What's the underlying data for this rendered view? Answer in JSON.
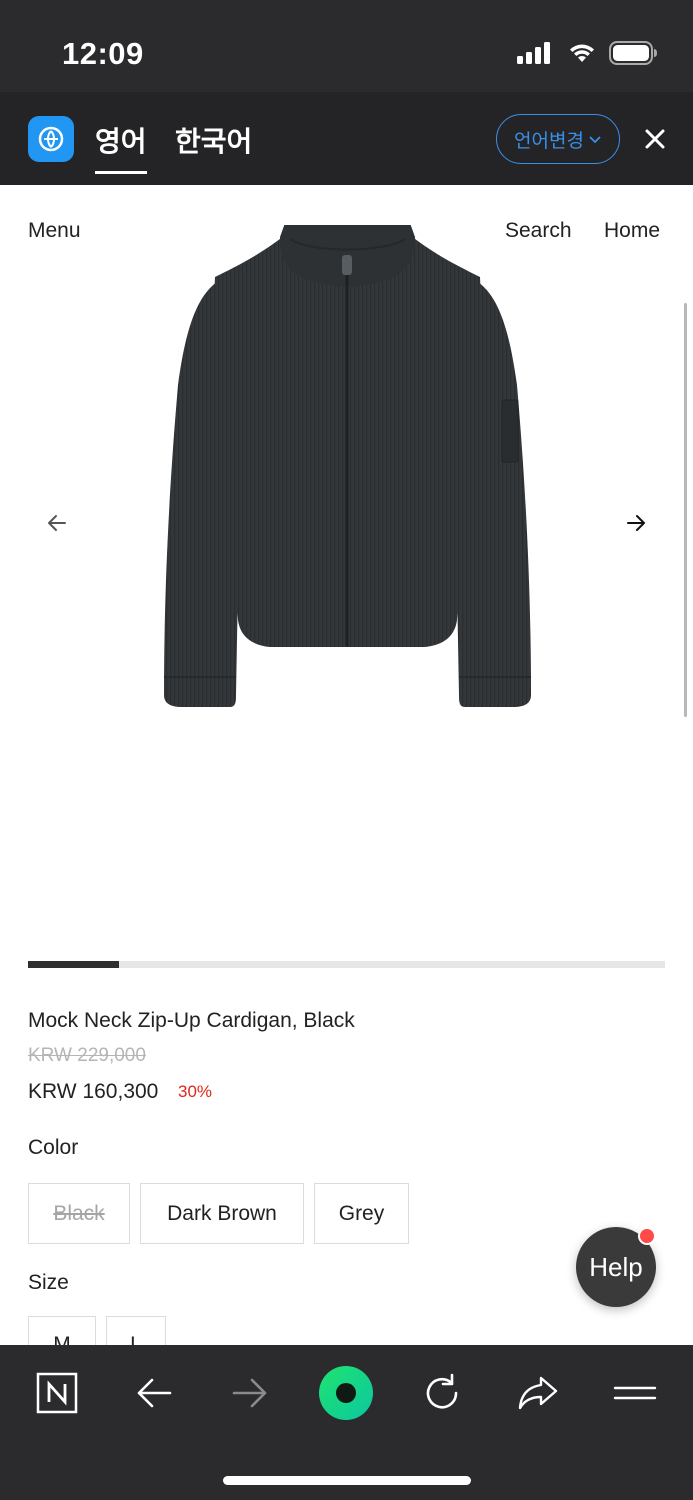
{
  "status_bar": {
    "time": "12:09",
    "icons": [
      "signal-icon",
      "wifi-icon",
      "battery-icon"
    ]
  },
  "translate_bar": {
    "logo_icon": "translate-app-icon",
    "tabs": [
      {
        "label": "영어",
        "active": true
      },
      {
        "label": "한국어",
        "active": false
      }
    ],
    "change_language_label": "언어변경",
    "close_icon": "close-icon",
    "accent_color": "#3a8fe8"
  },
  "page_nav": {
    "menu_label": "Menu",
    "search_label": "Search",
    "home_label": "Home"
  },
  "gallery": {
    "image_icon": "cardigan-photo",
    "prev_icon": "arrow-left-icon",
    "next_icon": "arrow-right-icon",
    "progress_fraction": 0.143
  },
  "product": {
    "name": "Mock Neck Zip-Up Cardigan, Black",
    "original_price": "KRW 229,000",
    "sale_price": "KRW 160,300",
    "discount": "30%",
    "discount_color": "#e0261b"
  },
  "color_section": {
    "label": "Color",
    "options": [
      {
        "label": "Black",
        "available": false
      },
      {
        "label": "Dark Brown",
        "available": true
      },
      {
        "label": "Grey",
        "available": true
      }
    ]
  },
  "size_section": {
    "label": "Size",
    "options": [
      "M",
      "L"
    ]
  },
  "help_button": {
    "label": "Help",
    "badge_color": "#ff4a4a"
  },
  "toolbar": {
    "items": [
      "naver-n-icon",
      "back-arrow-icon",
      "forward-arrow-icon",
      "green-dot-icon",
      "refresh-icon",
      "share-icon",
      "hamburger-menu-icon"
    ],
    "center_color": "#12d07a"
  }
}
